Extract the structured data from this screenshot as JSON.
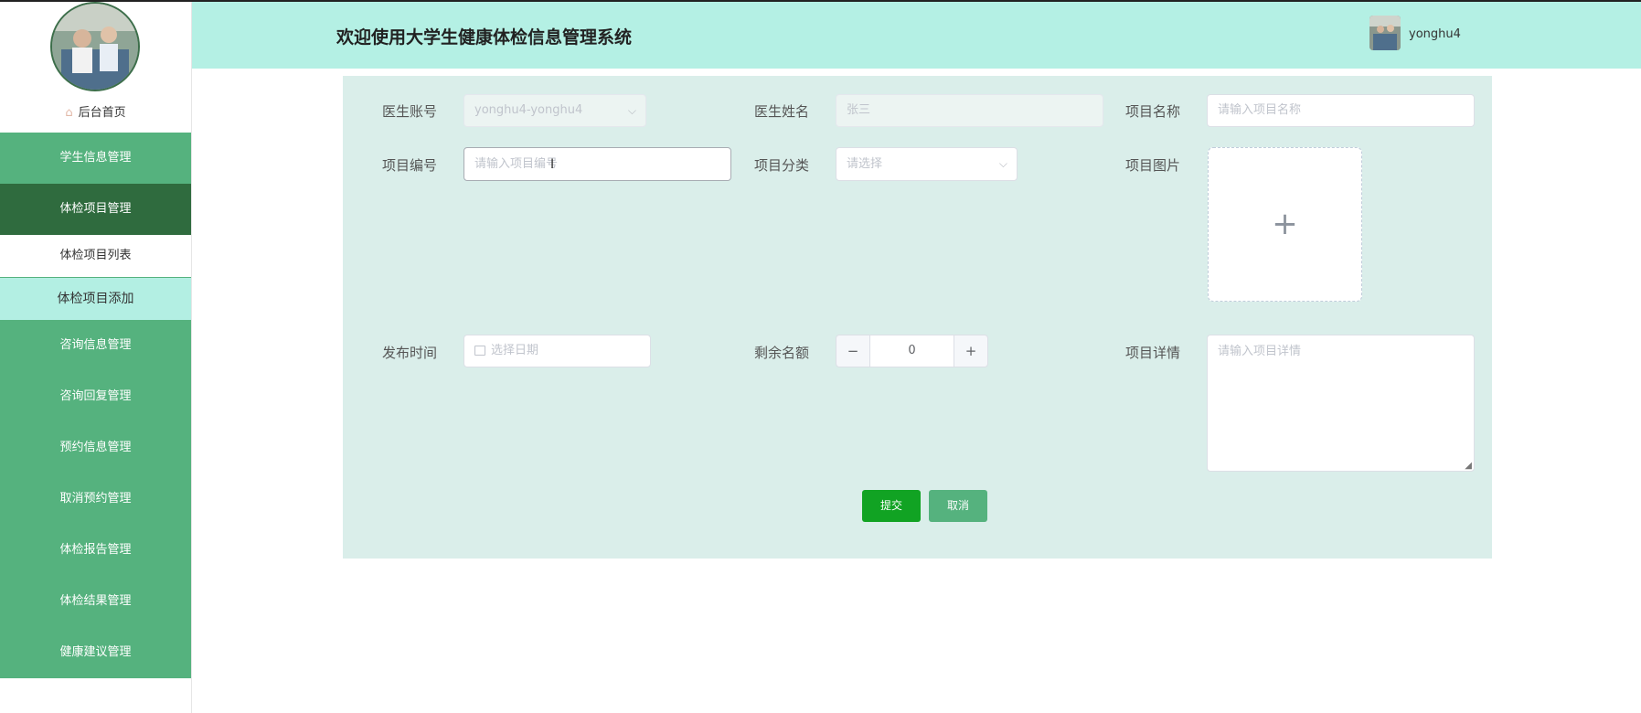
{
  "header": {
    "title": "欢迎使用大学生健康体检信息管理系统",
    "username": "yonghu4"
  },
  "sidebar": {
    "home_label": "后台首页",
    "items": [
      {
        "label": "学生信息管理"
      },
      {
        "label": "体检项目管理"
      },
      {
        "label": "体检项目列表"
      },
      {
        "label": "体检项目添加"
      },
      {
        "label": "咨询信息管理"
      },
      {
        "label": "咨询回复管理"
      },
      {
        "label": "预约信息管理"
      },
      {
        "label": "取消预约管理"
      },
      {
        "label": "体检报告管理"
      },
      {
        "label": "体检结果管理"
      },
      {
        "label": "健康建议管理"
      }
    ]
  },
  "form": {
    "doctor_account": {
      "label": "医生账号",
      "value": "yonghu4-yonghu4"
    },
    "doctor_name": {
      "label": "医生姓名",
      "value": "张三"
    },
    "project_name": {
      "label": "项目名称",
      "placeholder": "请输入项目名称"
    },
    "project_code": {
      "label": "项目编号",
      "placeholder": "请输入项目编号"
    },
    "project_category": {
      "label": "项目分类",
      "placeholder": "请选择"
    },
    "project_image": {
      "label": "项目图片",
      "plus": "+"
    },
    "publish_time": {
      "label": "发布时间",
      "placeholder": "选择日期"
    },
    "remaining": {
      "label": "剩余名额",
      "value": "0",
      "minus": "−",
      "plus": "+"
    },
    "details": {
      "label": "项目详情",
      "placeholder": "请输入项目详情"
    },
    "submit_label": "提交",
    "cancel_label": "取消"
  },
  "colors": {
    "header_bg": "#b4f0e4",
    "menu_bg": "#55b27e",
    "menu_active": "#2f6b3e",
    "submit": "#11a323",
    "cancel": "#55b27e",
    "panel_bg": "#daeeea"
  },
  "icons": [
    "home-icon",
    "chevron-down-icon",
    "calendar-icon",
    "plus-icon",
    "minus-icon",
    "text-cursor-icon",
    "resize-handle-icon"
  ]
}
